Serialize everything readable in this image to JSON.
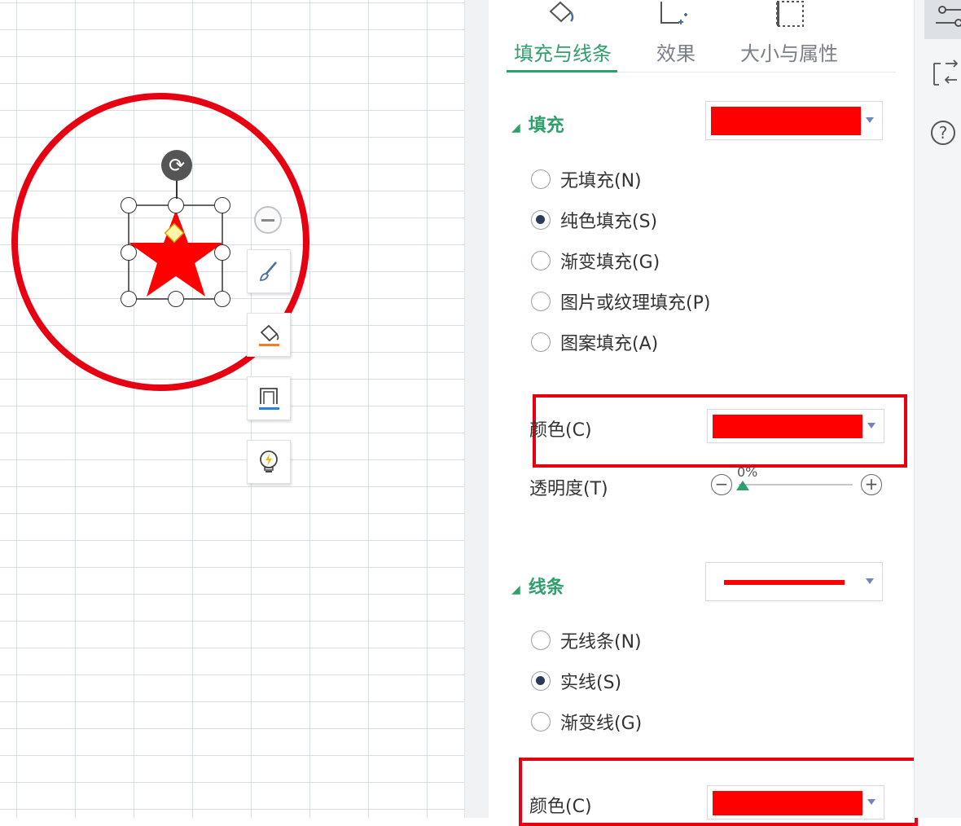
{
  "tabs": [
    {
      "label": "填充与线条",
      "icon": "fill-bucket-icon",
      "active": true
    },
    {
      "label": "效果",
      "icon": "effects-icon",
      "active": false
    },
    {
      "label": "大小与属性",
      "icon": "size-properties-icon",
      "active": false
    }
  ],
  "fill": {
    "title": "填充",
    "color": "#ff0000",
    "options": [
      {
        "label": "无填充(N)",
        "checked": false
      },
      {
        "label": "纯色填充(S)",
        "checked": true
      },
      {
        "label": "渐变填充(G)",
        "checked": false
      },
      {
        "label": "图片或纹理填充(P)",
        "checked": false
      },
      {
        "label": "图案填充(A)",
        "checked": false
      }
    ],
    "color_label": "颜色(C)",
    "transparency_label": "透明度(T)",
    "transparency_value": "0%"
  },
  "line": {
    "title": "线条",
    "color": "#ff0000",
    "options": [
      {
        "label": "无线条(N)",
        "checked": false
      },
      {
        "label": "实线(S)",
        "checked": true
      },
      {
        "label": "渐变线(G)",
        "checked": false
      }
    ],
    "color_label": "颜色(C)"
  },
  "shape": {
    "name": "star",
    "fill_color": "#ff0000"
  },
  "colors": {
    "accent": "#2f9f6b",
    "highlight": "#e60012"
  },
  "quick_toolbar": [
    "minus-icon",
    "brush-icon",
    "fill-icon",
    "outline-icon",
    "lightbulb-icon"
  ],
  "right_toolbar": [
    "properties-icon",
    "selection-icon",
    "help-icon"
  ]
}
